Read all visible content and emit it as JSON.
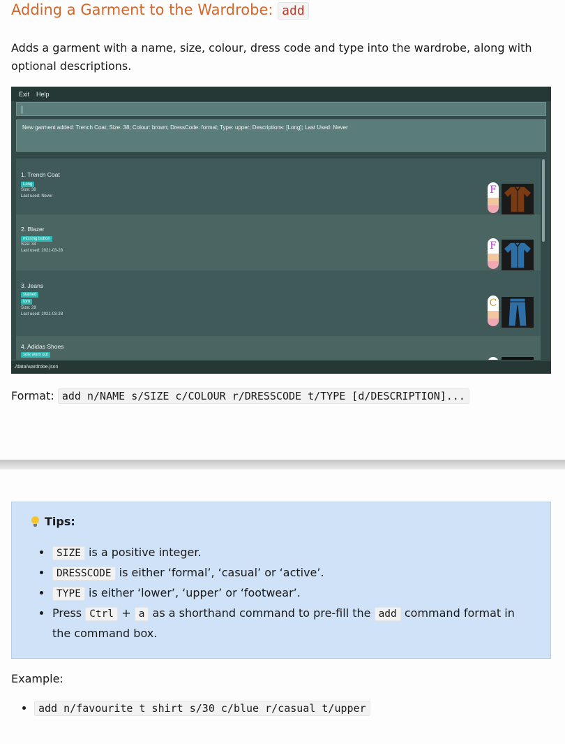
{
  "section": {
    "title": "Adding a Garment to the Wardrobe:",
    "title_code": "add",
    "intro": "Adds a garment with a name, size, colour, dress code and type into the wardrobe, along with optional descriptions."
  },
  "app": {
    "menu": [
      "Exit",
      "Help"
    ],
    "command_value": "|",
    "result": "New garment added: Trench Coat; Size: 38; Colour: brown; DressCode: formal; Type: upper; Descriptions: [Long]; Last Used: Never",
    "garments": [
      {
        "name": "1. Trench Coat",
        "tags": [
          "Long"
        ],
        "size": "Size: 38",
        "last_used": "Last used: Never",
        "dresscode": "F",
        "colour": "#7a3b12"
      },
      {
        "name": "2. Blazer",
        "tags": [
          "missing button"
        ],
        "size": "Size: 34",
        "last_used": "Last used: 2021-03-28",
        "dresscode": "F",
        "colour": "#2f6fa8"
      },
      {
        "name": "3. Jeans",
        "tags": [
          "stained",
          "torn"
        ],
        "size": "Size: 29",
        "last_used": "Last used: 2021-03-28",
        "dresscode": "C",
        "colour": "#2f6fa8"
      },
      {
        "name": "4. Adidas Shoes",
        "tags": [
          "sole worn out"
        ]
      }
    ],
    "status": "./data/wardrobe.json"
  },
  "format": {
    "label": "Format:",
    "code": "add n/NAME s/SIZE c/COLOUR r/DRESSCODE t/TYPE [d/DESCRIPTION]..."
  },
  "tips": {
    "heading": "Tips:",
    "items": [
      {
        "code": "SIZE",
        "text": " is a positive integer."
      },
      {
        "code": "DRESSCODE",
        "text": " is either ‘formal’, ‘casual’ or ‘active’."
      },
      {
        "code": "TYPE",
        "text": " is either ‘lower’, ‘upper’ or ‘footwear’."
      },
      {
        "pre": "Press ",
        "code": "Ctrl",
        "plus": " + ",
        "code2": "a",
        "mid": " as a shorthand command to pre-fill the ",
        "code3": "add",
        "text": " command format in the command box."
      }
    ]
  },
  "example": {
    "label": "Example:",
    "items": [
      "add n/favourite t shirt s/30 c/blue r/casual t/upper"
    ]
  }
}
